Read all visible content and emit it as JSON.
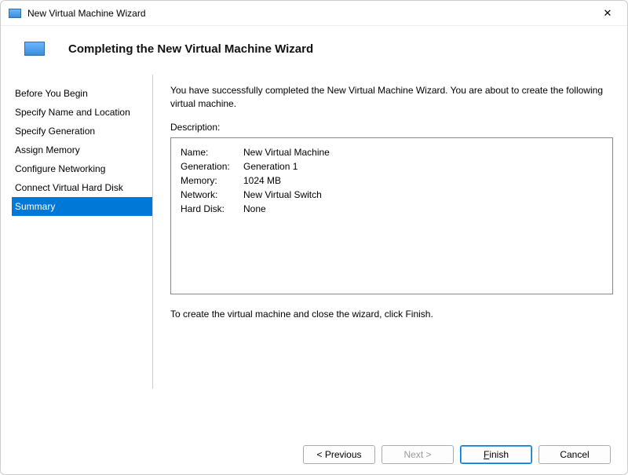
{
  "window": {
    "title": "New Virtual Machine Wizard"
  },
  "header": {
    "title": "Completing the New Virtual Machine Wizard"
  },
  "sidebar": {
    "steps": [
      "Before You Begin",
      "Specify Name and Location",
      "Specify Generation",
      "Assign Memory",
      "Configure Networking",
      "Connect Virtual Hard Disk",
      "Summary"
    ],
    "active_index": 6
  },
  "main": {
    "intro": "You have successfully completed the New Virtual Machine Wizard. You are about to create the following virtual machine.",
    "description_label": "Description:",
    "summary": {
      "name_label": "Name:",
      "name_value": "New Virtual Machine",
      "generation_label": "Generation:",
      "generation_value": "Generation 1",
      "memory_label": "Memory:",
      "memory_value": "1024 MB",
      "network_label": "Network:",
      "network_value": "New Virtual Switch",
      "harddisk_label": "Hard Disk:",
      "harddisk_value": "None"
    },
    "closing": "To create the virtual machine and close the wizard, click Finish."
  },
  "buttons": {
    "previous_prefix": "< ",
    "previous": "Previous",
    "next": "Next",
    "next_suffix": " >",
    "finish": "Finish",
    "cancel": "Cancel"
  }
}
